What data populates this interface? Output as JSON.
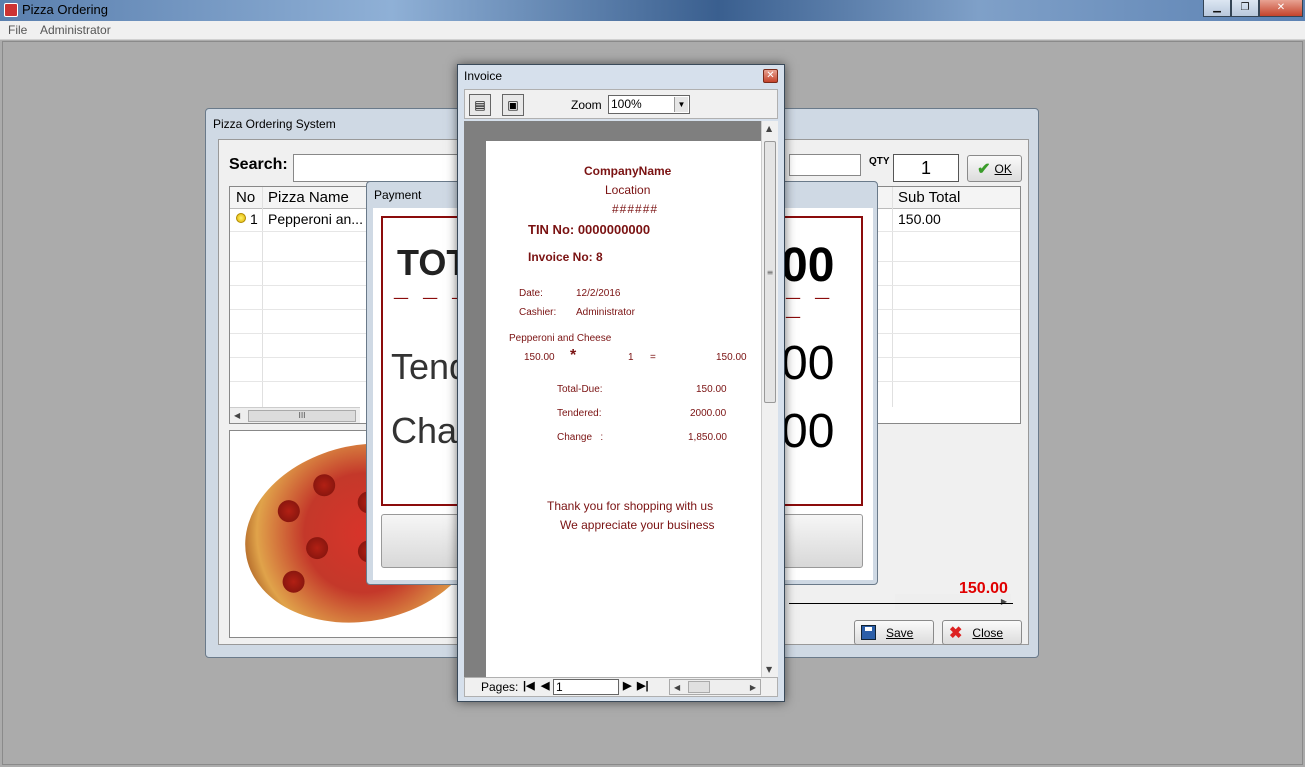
{
  "app": {
    "title": "Pizza Ordering",
    "menu": [
      "File",
      "Administrator"
    ],
    "window_buttons": [
      "minimize",
      "restore",
      "close"
    ]
  },
  "pos": {
    "title": "Pizza Ordering System",
    "search_label": "Search:",
    "qty_label": "QTY",
    "qty_value": "1",
    "ok_label": "OK",
    "columns": [
      "No",
      "Pizza Name",
      "Sub Total"
    ],
    "rows": [
      {
        "no": "1",
        "name": "Pepperoni an...",
        "sub_total": "150.00"
      }
    ],
    "total": "150.00",
    "save_label": "Save",
    "close_label": "Close"
  },
  "payment": {
    "title": "Payment",
    "total_partial": "TOT",
    "total_value_partial": "00",
    "tendered_partial": "Tend",
    "tendered_value_partial": "00",
    "change_partial": "Char",
    "change_value_partial": "00"
  },
  "invoice": {
    "title": "Invoice",
    "zoom_label": "Zoom",
    "zoom_value": "100%",
    "pages_label": "Pages:",
    "page_value": "1",
    "company": "CompanyName",
    "location": "Location",
    "hashes": "######",
    "tin": "TIN No: 0000000000",
    "invoice_no": "Invoice No:  8",
    "date_label": "Date:",
    "date_value": "12/2/2016",
    "cashier_label": "Cashier:",
    "cashier_value": "Administrator",
    "item_name": "Pepperoni and Cheese",
    "item_price": "150.00",
    "item_star": "*",
    "item_qty": "1",
    "item_eq": "=",
    "item_total": "150.00",
    "total_due_label": "Total-Due:",
    "total_due_value": "150.00",
    "tendered_label": "Tendered:",
    "tendered_value": "2000.00",
    "change_label": "Change   :",
    "change_value": "1,850.00",
    "thanks_1": "Thank you for shopping with us",
    "thanks_2": "We appreciate your business"
  },
  "colors": {
    "invoice_text": "#7a1212",
    "total_red": "#e00000",
    "payment_frame": "#8b0c0c"
  }
}
